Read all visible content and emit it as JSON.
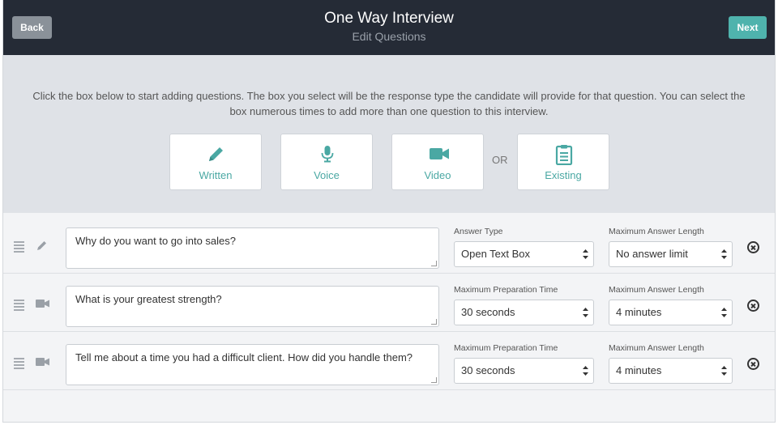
{
  "header": {
    "back_label": "Back",
    "next_label": "Next",
    "title": "One Way Interview",
    "subtitle": "Edit Questions"
  },
  "chooser": {
    "instructions": "Click the box below to start adding questions. The box you select will be the response type the candidate will provide for that question. You can select the box numerous times to add more than one question to this interview.",
    "or_label": "OR",
    "tiles": [
      {
        "label": "Written",
        "icon": "pencil-icon"
      },
      {
        "label": "Voice",
        "icon": "microphone-icon"
      },
      {
        "label": "Video",
        "icon": "video-camera-icon"
      },
      {
        "label": "Existing",
        "icon": "clipboard-icon"
      }
    ]
  },
  "questions": [
    {
      "type_icon": "pencil-icon",
      "text": "Why do you want to go into sales?",
      "field1_label": "Answer Type",
      "field1_value": "Open Text Box",
      "field2_label": "Maximum Answer Length",
      "field2_value": "No answer limit"
    },
    {
      "type_icon": "video-camera-icon",
      "text": "What is your greatest strength?",
      "field1_label": "Maximum Preparation Time",
      "field1_value": "30 seconds",
      "field2_label": "Maximum Answer Length",
      "field2_value": "4 minutes"
    },
    {
      "type_icon": "video-camera-icon",
      "text": "Tell me about a time you had a difficult client. How did you handle them?",
      "field1_label": "Maximum Preparation Time",
      "field1_value": "30 seconds",
      "field2_label": "Maximum Answer Length",
      "field2_value": "4 minutes"
    }
  ],
  "colors": {
    "header_bg": "#252b36",
    "accent": "#4fb3ad",
    "back_button": "#8a9199"
  }
}
